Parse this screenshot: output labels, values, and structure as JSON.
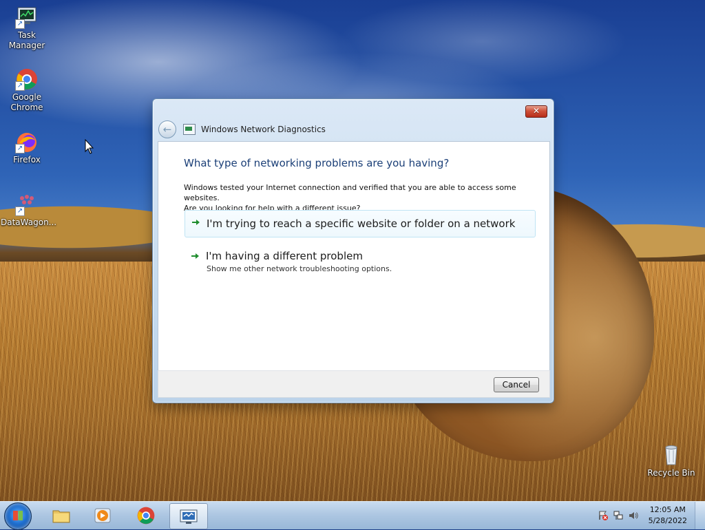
{
  "desktop": {
    "icons": [
      {
        "label": "Task Manager",
        "icon": "task-manager-icon"
      },
      {
        "label": "Google Chrome",
        "icon": "chrome-icon"
      },
      {
        "label": "Firefox",
        "icon": "firefox-icon"
      },
      {
        "label": "DataWagon...",
        "icon": "datawagon-icon"
      },
      {
        "label": "Recycle Bin",
        "icon": "recycle-bin-icon"
      }
    ]
  },
  "dialog": {
    "title": "Windows Network Diagnostics",
    "heading": "What type of networking problems are you having?",
    "description_line1": "Windows tested your Internet connection and verified that you are able to access some websites.",
    "description_line2": "Are you looking for help with a different issue?",
    "options": [
      {
        "title": "I'm trying to reach a specific website or folder on a network",
        "subtitle": ""
      },
      {
        "title": "I'm having a different problem",
        "subtitle": "Show me other network troubleshooting options."
      }
    ],
    "cancel_label": "Cancel",
    "close_glyph": "✕"
  },
  "taskbar": {
    "apps": [
      {
        "name": "Windows Explorer",
        "icon": "folder-icon"
      },
      {
        "name": "Windows Media Player",
        "icon": "media-player-icon"
      },
      {
        "name": "Google Chrome",
        "icon": "chrome-icon"
      },
      {
        "name": "Windows Network Diagnostics",
        "icon": "network-diagnostics-icon",
        "active": true
      }
    ],
    "clock": {
      "time": "12:05 AM",
      "date": "5/28/2022"
    }
  },
  "colors": {
    "heading": "#1b3f77",
    "option_arrow": "#1e8c2d",
    "close_button": "#c6432c"
  }
}
